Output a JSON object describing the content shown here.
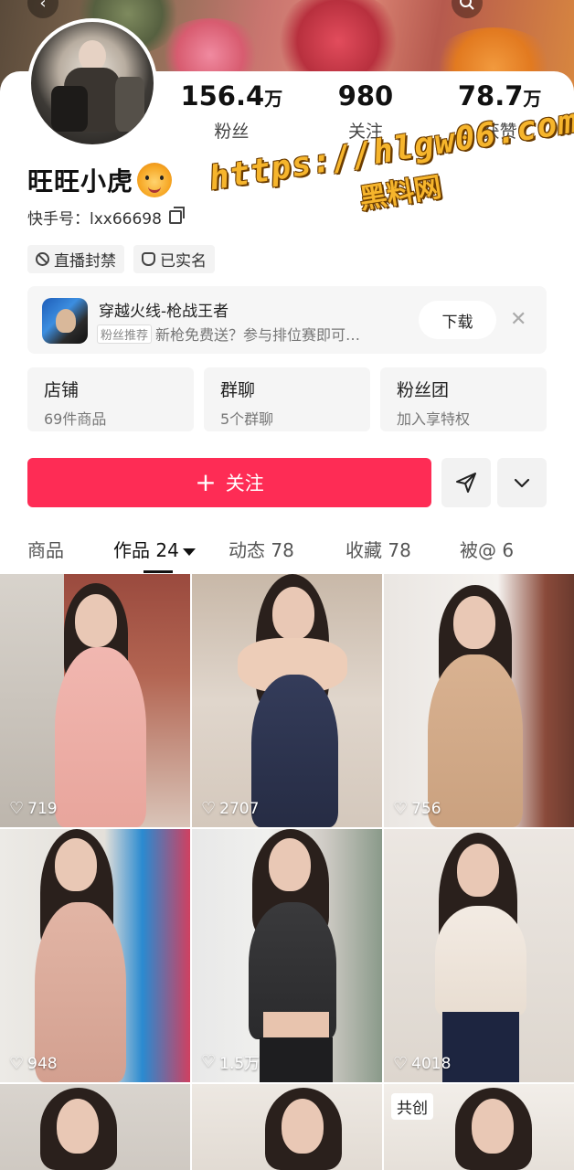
{
  "profile": {
    "name": "旺旺小虎",
    "kuaishou_id_label": "快手号：lxx66698",
    "stats": [
      {
        "num": "156.4",
        "unit": "万",
        "label": "粉丝"
      },
      {
        "num": "980",
        "unit": "",
        "label": "关注"
      },
      {
        "num": "78.7",
        "unit": "万",
        "label": "获赞"
      }
    ],
    "tags": [
      "直播封禁",
      "已实名"
    ]
  },
  "watermark": {
    "line1": "https://hlgw06.com",
    "line2": "黑料网"
  },
  "ad": {
    "title": "穿越火线-枪战王者",
    "badge": "粉丝推荐",
    "subtitle": "新枪免费送？参与排位赛即可…",
    "button": "下载",
    "close": "✕"
  },
  "features": [
    {
      "title": "店铺",
      "sub": "69件商品"
    },
    {
      "title": "群聊",
      "sub": "5个群聊"
    },
    {
      "title": "粉丝团",
      "sub": "加入享特权"
    }
  ],
  "follow_button": {
    "plus": "+",
    "label": "关注"
  },
  "tabs": [
    {
      "label": "商品"
    },
    {
      "label": "作品 24"
    },
    {
      "label": "动态 78"
    },
    {
      "label": "收藏 78"
    },
    {
      "label": "被@ 6"
    }
  ],
  "videos": [
    {
      "likes": "719",
      "icon": "heart-icon"
    },
    {
      "likes": "2707",
      "icon": "heart-icon"
    },
    {
      "likes": "756",
      "icon": "heart-icon"
    },
    {
      "likes": "948",
      "icon": "heart-icon"
    },
    {
      "likes": "1.5万",
      "icon": "heart-icon"
    },
    {
      "likes": "4018",
      "icon": "heart-icon"
    },
    {
      "likes": "",
      "icon": "heart-icon"
    },
    {
      "likes": "",
      "icon": "heart-icon"
    },
    {
      "likes": "",
      "icon": "heart-icon",
      "badge": "共创"
    }
  ]
}
